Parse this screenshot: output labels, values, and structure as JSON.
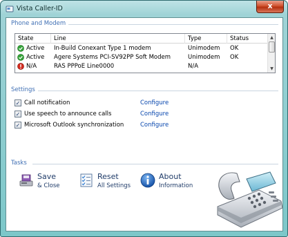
{
  "window": {
    "title": "Vista Caller-ID",
    "close_label": "x"
  },
  "phone_modem": {
    "group_label": "Phone and Modem",
    "columns": [
      "State",
      "Line",
      "Type",
      "Status"
    ],
    "rows": [
      {
        "state": "Active",
        "state_icon": "green-check",
        "line": "In-Build Conexant Type 1 modem",
        "type": "Unimodem",
        "status": "OK"
      },
      {
        "state": "Active",
        "state_icon": "green-check",
        "line": "Agere Systems PCI-SV92PP Soft Modem",
        "type": "Unimodem",
        "status": "OK"
      },
      {
        "state": "N/A",
        "state_icon": "red-exclamation",
        "line": "RAS PPPoE Line0000",
        "type": "N/A",
        "status": ""
      }
    ]
  },
  "settings": {
    "group_label": "Settings",
    "items": [
      {
        "label": "Call notification",
        "checked": true,
        "link": "Configure"
      },
      {
        "label": "Use speech to announce calls",
        "checked": true,
        "link": "Configure"
      },
      {
        "label": "Microsoft Outlook synchronization",
        "checked": true,
        "link": "Configure"
      }
    ]
  },
  "tasks": {
    "group_label": "Tasks",
    "items": [
      {
        "main": "Save",
        "sub": "& Close",
        "icon": "save-icon"
      },
      {
        "main": "Reset",
        "sub": "All Settings",
        "icon": "reset-checklist-icon"
      },
      {
        "main": "About",
        "sub": "Information",
        "icon": "info-icon"
      }
    ]
  },
  "colors": {
    "group_label": "#3f6fb4",
    "link": "#0645ad",
    "titlebar": "#9fd3d6",
    "close": "#c8432a"
  }
}
